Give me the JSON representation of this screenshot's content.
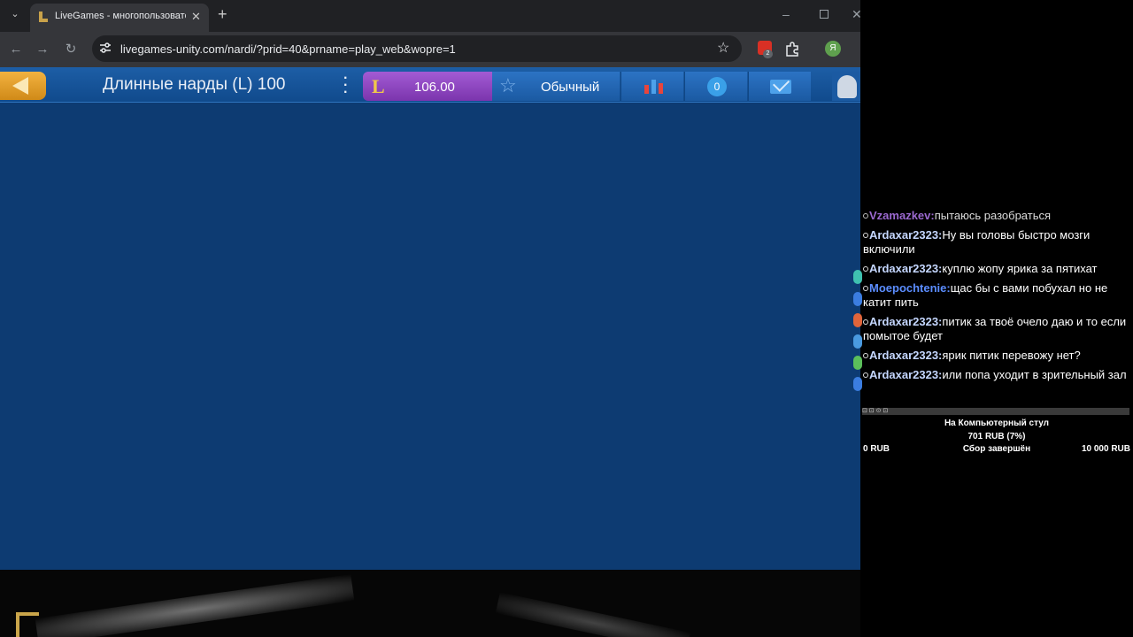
{
  "browser": {
    "tab": {
      "title": "LiveGames - многопользовате"
    },
    "url": "livegames-unity.com/nardi/?prid=40&prname=play_web&wopre=1",
    "extension_badge_count": "2",
    "profile_initial": "Я"
  },
  "game": {
    "title": "Длинные нарды (L) 100",
    "coins": "106.00",
    "mode": "Обычный",
    "notifications": "0",
    "colors": {
      "header": "#1d5ea6",
      "background": "#0d3b72",
      "coins_bg": "#a35bd4",
      "back_btn": "#f2b240"
    }
  },
  "chat": {
    "messages": [
      {
        "user": "Vzamazkev:",
        "text": "пытаюсь разобраться",
        "color": "#b77cf5"
      },
      {
        "user": "Ardaxar2323:",
        "text": "Ну вы головы быстро мозги включили",
        "color": "#c5d7ff"
      },
      {
        "user": "Ardaxar2323:",
        "text": "куплю жопу ярика за пятихат",
        "color": "#c5d7ff"
      },
      {
        "user": "Moepochtenie:",
        "text": "щас бы с вами побухал но не катит пить",
        "color": "#5b8dff"
      },
      {
        "user": "Ardaxar2323:",
        "text": "питик за твоё очело даю и то если помытое будет",
        "color": "#c5d7ff"
      },
      {
        "user": "Ardaxar2323:",
        "text": "ярик питик перевожу нет?",
        "color": "#c5d7ff"
      },
      {
        "user": "Ardaxar2323:",
        "text": "или попа уходит в зрительный зал",
        "color": "#c5d7ff"
      }
    ]
  },
  "donation_goal": {
    "title": "На Компьютерный стул",
    "amount": "701 RUB (7%)",
    "min": "0 RUB",
    "status": "Сбор завершён",
    "max": "10 000 RUB",
    "progress": 0.07
  }
}
